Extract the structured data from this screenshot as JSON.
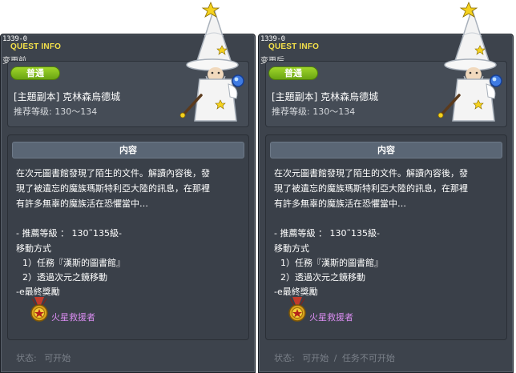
{
  "quest_id": "1339-0",
  "header_label": "QUEST INFO",
  "panels": [
    {
      "change_label": "变更前",
      "badge": "普通",
      "title": "[主題副本] 克林森烏德城",
      "rec_level": "推荐等级:  130～134",
      "content_header": "内容",
      "desc_lines": [
        "在次元圖書館發現了陌生的文件。解讀內容後，發",
        "現了被遺忘的魔族瑪斯特利亞大陸的訊息，在那裡",
        "有許多無辜的魔族活在恐懼當中…"
      ],
      "rec_line": "- 推薦等級  ：  130˜135級-",
      "move_title": "移動方式",
      "move_1": "1）任務『漢斯的圖書館』",
      "move_2": "2）透過次元之鏡移動",
      "reward_title": "-e最終獎勵",
      "reward_name": "火星救援者",
      "status_label": "状态:",
      "status_values": [
        "可开始"
      ]
    },
    {
      "change_label": "变更后",
      "badge": "普通",
      "title": "[主題副本] 克林森烏德城",
      "rec_level": "推荐等级:  130～134",
      "content_header": "内容",
      "desc_lines": [
        "在次元圖書館發現了陌生的文件。解讀內容後，發",
        "現了被遺忘的魔族瑪斯特利亞大陸的訊息，在那裡",
        "有許多無辜的魔族活在恐懼當中…"
      ],
      "rec_line": "- 推薦等級  ：  130˜135級-",
      "move_title": "移動方式",
      "move_1": "1）任務『漢斯的圖書館』",
      "move_2": "2）透過次元之鏡移動",
      "reward_title": "-e最終獎勵",
      "reward_name": "火星救援者",
      "status_label": "状态:",
      "status_values": [
        "可开始",
        "任务不可开始"
      ],
      "status_separator": "/"
    }
  ],
  "colors": {
    "panel_bg": "#3d434c",
    "badge_green": "#8cc61f",
    "title_yellow": "#f5e14a",
    "reward_purple": "#d98cf0",
    "status_gray": "#7a8089"
  },
  "icons": {
    "npc": "wizard-npc-icon",
    "reward": "medal-icon"
  }
}
